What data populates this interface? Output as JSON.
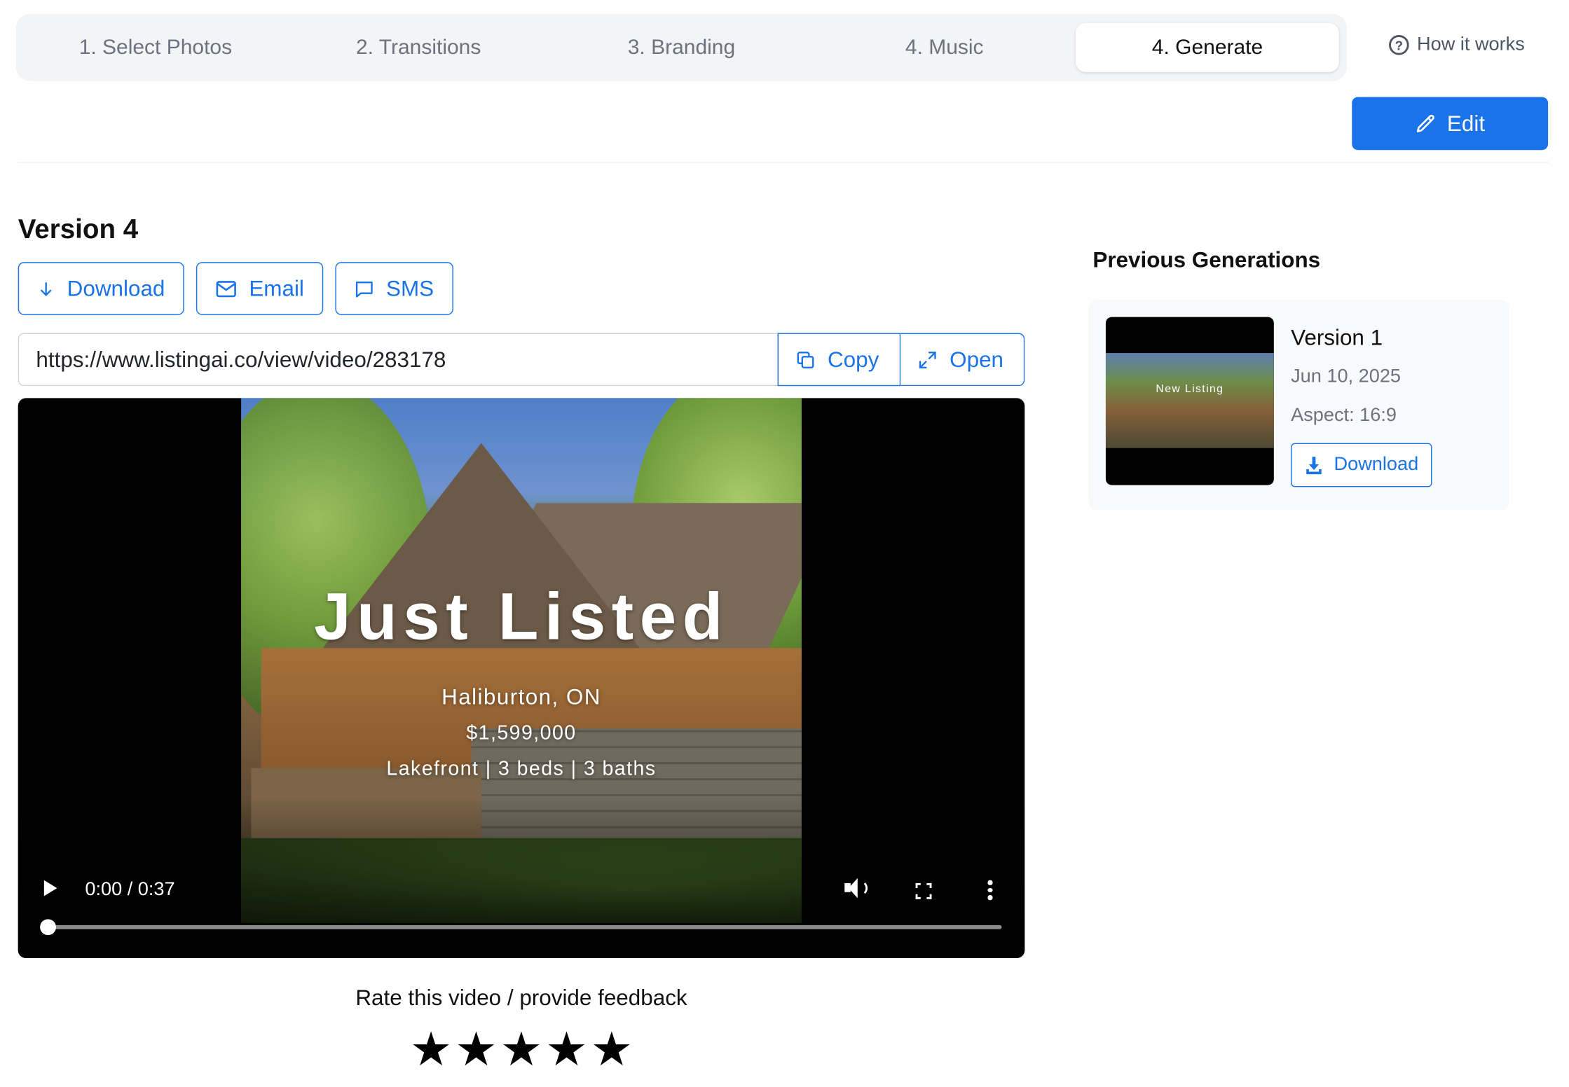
{
  "stepper": {
    "steps": [
      {
        "label": "1. Select Photos"
      },
      {
        "label": "2. Transitions"
      },
      {
        "label": "3. Branding"
      },
      {
        "label": "4. Music"
      },
      {
        "label": "4. Generate"
      }
    ],
    "active_index": 4,
    "how_it_works_label": "How it works"
  },
  "toolbar": {
    "edit_label": "Edit"
  },
  "main": {
    "version_title": "Version 4",
    "actions": {
      "download_label": "Download",
      "email_label": "Email",
      "sms_label": "SMS"
    },
    "share": {
      "url": "https://www.listingai.co/view/video/283178",
      "copy_label": "Copy",
      "open_label": "Open"
    },
    "video": {
      "overlay_title": "Just Listed",
      "overlay_location": "Haliburton, ON",
      "overlay_price": "$1,599,000",
      "overlay_details": "Lakefront | 3 beds | 3 baths",
      "time_display": "0:00 / 0:37",
      "progress": 0
    },
    "feedback": {
      "prompt": "Rate this video / provide feedback",
      "stars": 5
    }
  },
  "sidebar": {
    "title": "Previous Generations",
    "generations": [
      {
        "name": "Version 1",
        "date": "Jun 10, 2025",
        "aspect": "Aspect: 16:9",
        "thumbnail_text": "New Listing",
        "download_label": "Download"
      }
    ]
  },
  "colors": {
    "accent": "#1a73e8",
    "stepper_bg": "#f3f4f6",
    "muted_text": "#6b7280"
  }
}
